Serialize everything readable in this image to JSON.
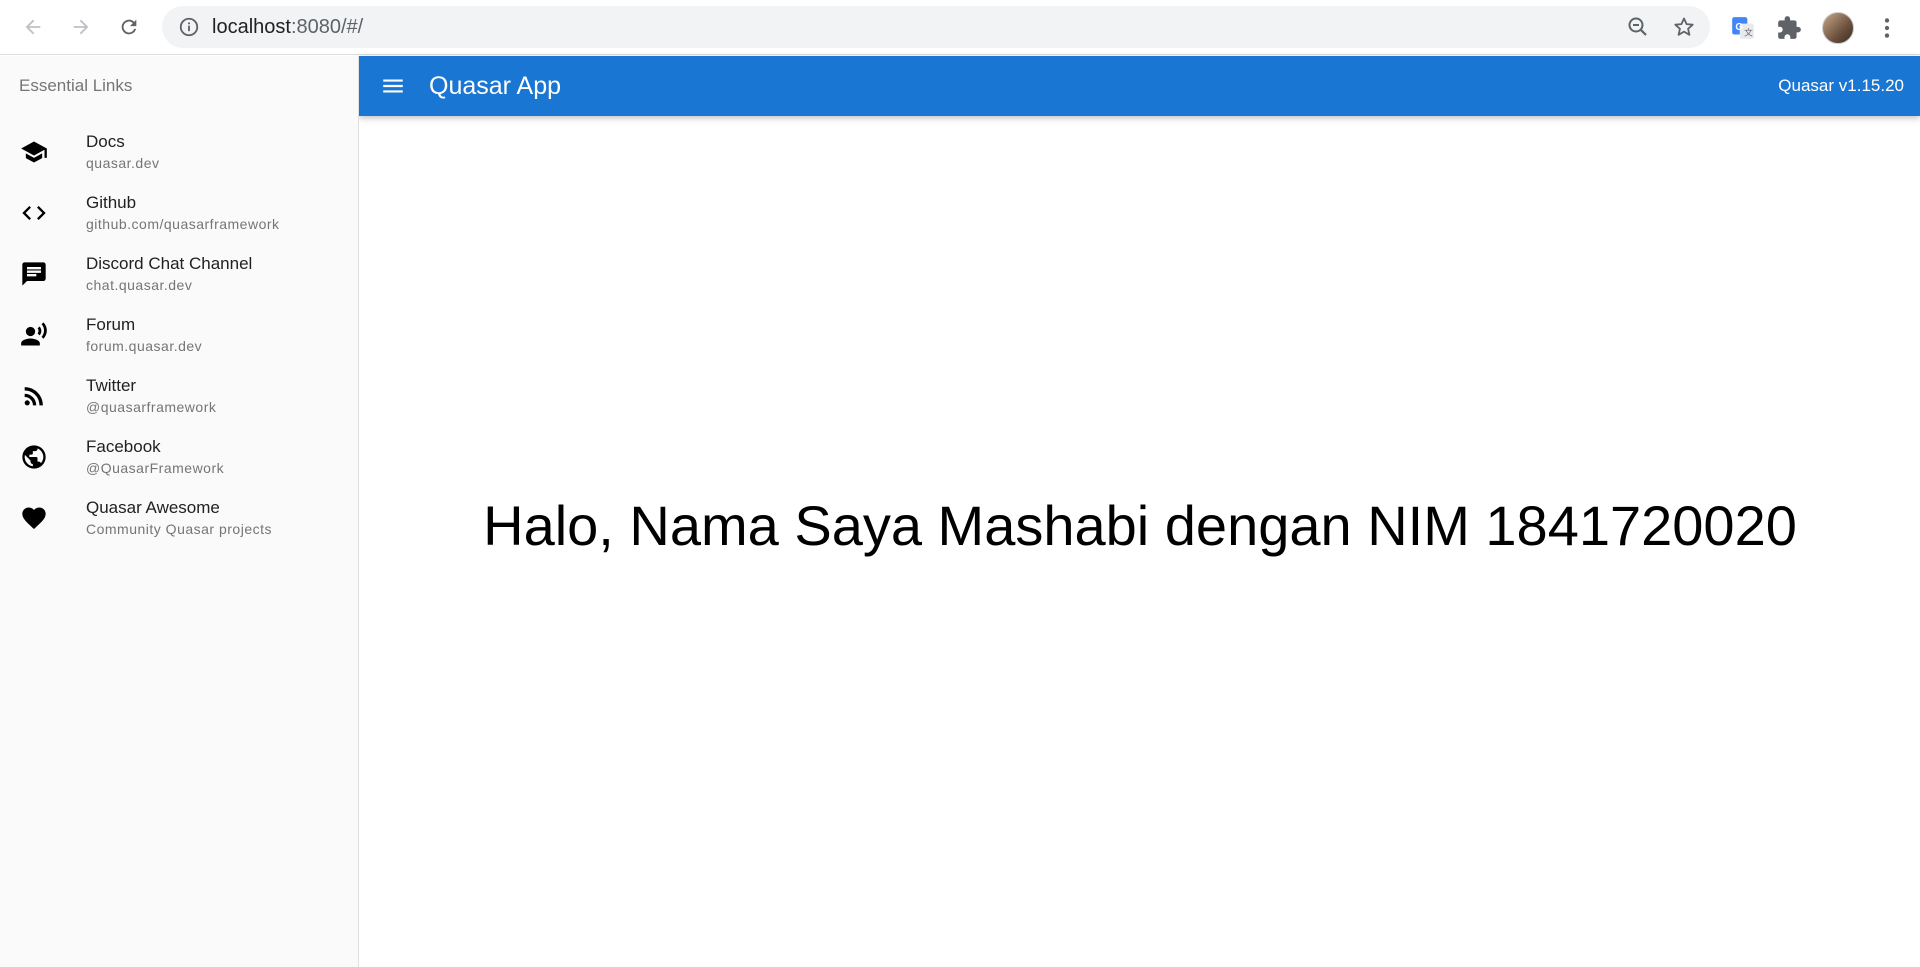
{
  "browser": {
    "url_host": "localhost",
    "url_path": ":8080/#/"
  },
  "app": {
    "title": "Quasar App",
    "version": "Quasar v1.15.20",
    "accent_color": "#1976d2"
  },
  "drawer": {
    "header": "Essential Links",
    "links": [
      {
        "title": "Docs",
        "caption": "quasar.dev",
        "icon": "school-icon"
      },
      {
        "title": "Github",
        "caption": "github.com/quasarframework",
        "icon": "code-icon"
      },
      {
        "title": "Discord Chat Channel",
        "caption": "chat.quasar.dev",
        "icon": "chat-icon"
      },
      {
        "title": "Forum",
        "caption": "forum.quasar.dev",
        "icon": "record-voice-icon"
      },
      {
        "title": "Twitter",
        "caption": "@quasarframework",
        "icon": "rss-feed-icon"
      },
      {
        "title": "Facebook",
        "caption": "@QuasarFramework",
        "icon": "public-icon"
      },
      {
        "title": "Quasar Awesome",
        "caption": "Community Quasar projects",
        "icon": "favorite-icon"
      }
    ]
  },
  "main": {
    "greeting": "Halo, Nama Saya Mashabi dengan NIM 1841720020"
  }
}
